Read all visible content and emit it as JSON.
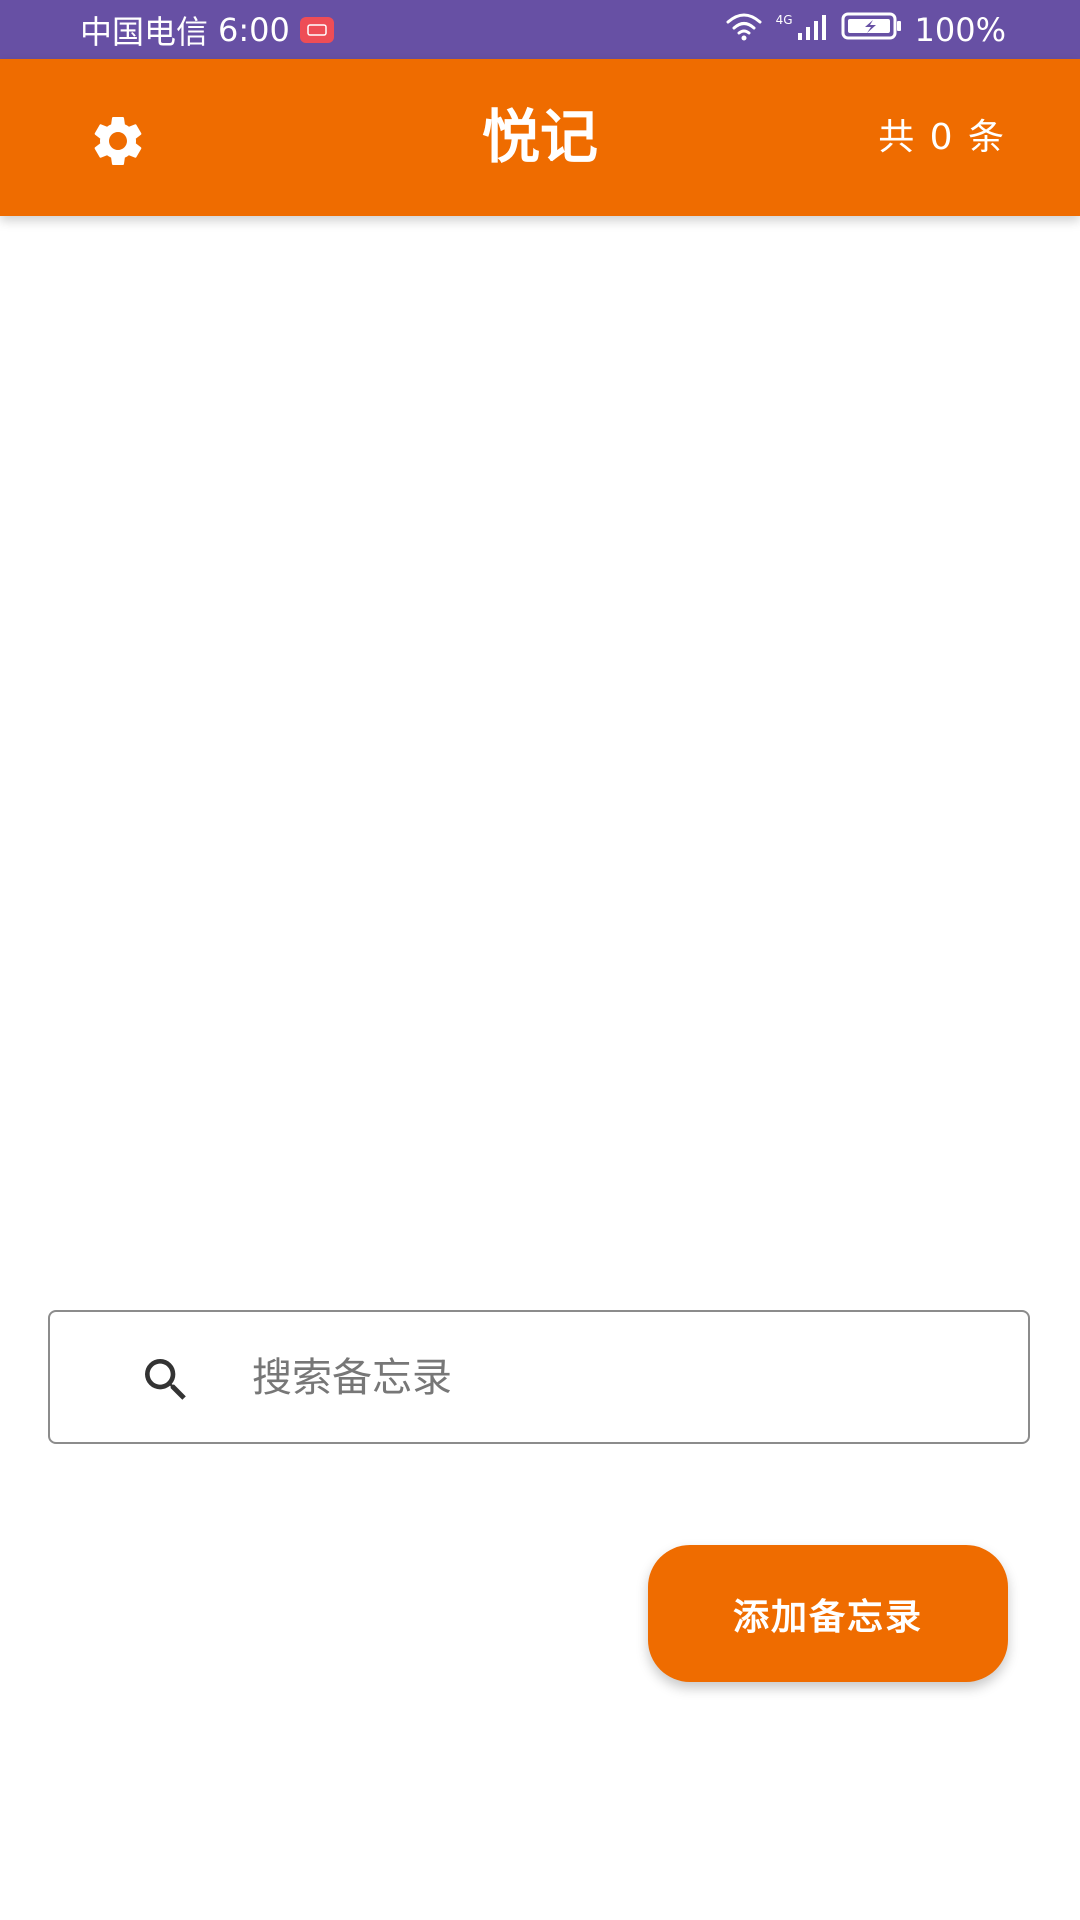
{
  "status_bar": {
    "carrier": "中国电信",
    "time": "6:00",
    "network": "4G",
    "battery": "100%"
  },
  "header": {
    "title": "悦记",
    "count_label": "共 0 条"
  },
  "search": {
    "placeholder": "搜索备忘录",
    "value": ""
  },
  "actions": {
    "add_label": "添加备忘录"
  },
  "colors": {
    "status_bar": "#6750a4",
    "accent": "#ef6c00"
  },
  "icons": {
    "settings": "gear-icon",
    "search": "search-icon"
  }
}
